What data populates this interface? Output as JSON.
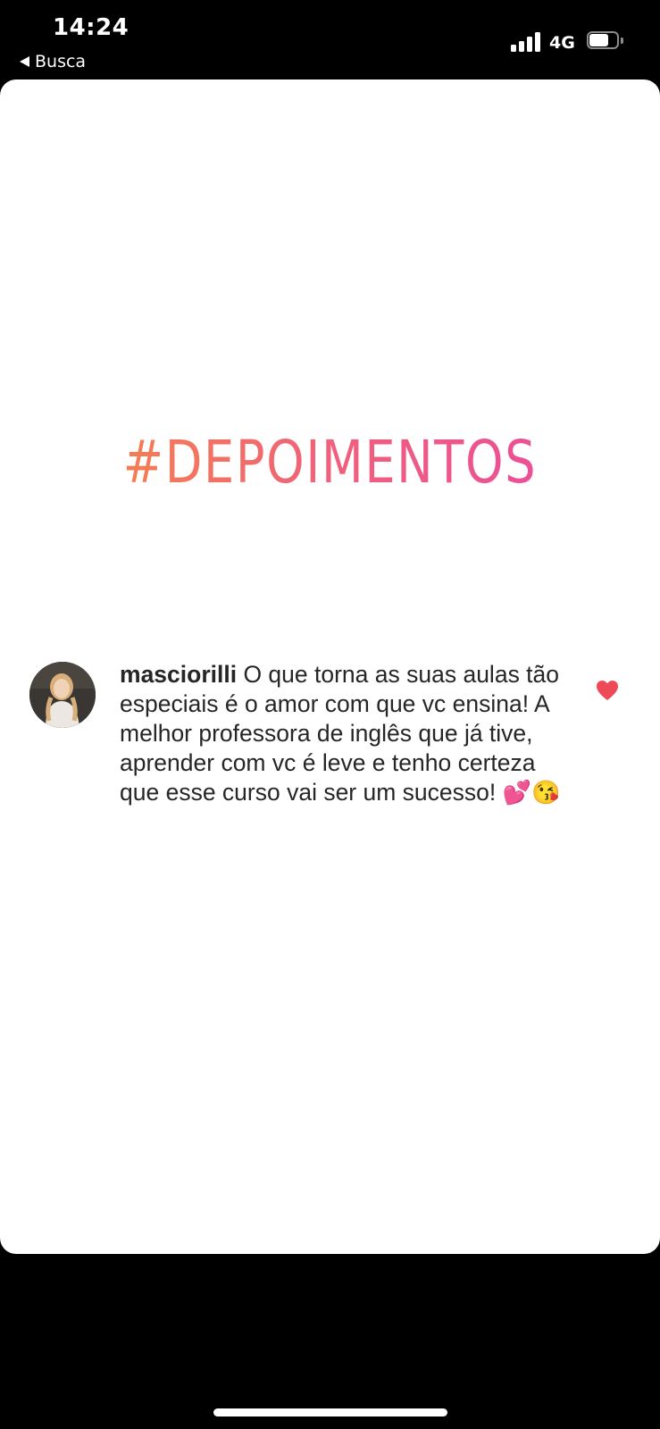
{
  "status_bar": {
    "time": "14:24",
    "back_label": "Busca",
    "network": "4G",
    "battery_level": 0.7
  },
  "story": {
    "hashtag": "#DEPOIMENTOS",
    "hashtag_colors": [
      "#f38746",
      "#f0617c",
      "#ea4a9e"
    ],
    "comment": {
      "username": "masciorilli",
      "text": " O que torna as suas aulas tão especiais é o amor com que vc ensina! A melhor professora de inglês que já tive, aprender com vc é leve e tenho certeza que esse curso vai ser um sucesso! ",
      "emojis": "💕😘",
      "liked": true,
      "like_color": "#ed4956"
    }
  },
  "icons": {
    "back": "back-arrow-icon",
    "signal": "signal-icon",
    "battery": "battery-icon",
    "like": "heart-icon",
    "avatar": "avatar"
  }
}
